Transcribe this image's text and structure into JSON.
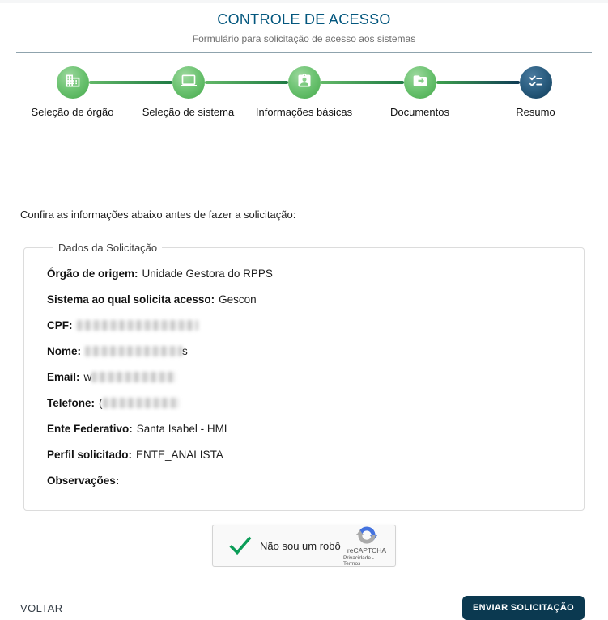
{
  "header": {
    "title": "CONTROLE DE ACESSO",
    "subtitle": "Formulário para solicitação de acesso aos sistemas"
  },
  "stepper": {
    "steps": [
      {
        "label": "Seleção de órgão",
        "icon": "building-icon",
        "state": "completed"
      },
      {
        "label": "Seleção de sistema",
        "icon": "laptop-icon",
        "state": "completed"
      },
      {
        "label": "Informações básicas",
        "icon": "person-badge-icon",
        "state": "completed"
      },
      {
        "label": "Documentos",
        "icon": "folder-move-icon",
        "state": "completed"
      },
      {
        "label": "Resumo",
        "icon": "checklist-icon",
        "state": "active"
      }
    ]
  },
  "main": {
    "instruction": "Confira as informações abaixo antes de fazer a solicitação:",
    "summary": {
      "legend": "Dados da Solicitação",
      "fields": [
        {
          "label": "Órgão de origem:",
          "value": "Unidade Gestora do RPPS",
          "masked": false
        },
        {
          "label": "Sistema ao qual solicita acesso:",
          "value": "Gescon",
          "masked": false
        },
        {
          "label": "CPF:",
          "value": "",
          "masked": true
        },
        {
          "label": "Nome:",
          "value": "",
          "masked": true,
          "suffix": "s"
        },
        {
          "label": "Email:",
          "prefix": "w",
          "value": "",
          "masked": true
        },
        {
          "label": "Telefone:",
          "prefix": "(",
          "value": "",
          "masked": true
        },
        {
          "label": "Ente Federativo:",
          "value": "Santa Isabel - HML",
          "masked": false
        },
        {
          "label": "Perfil solicitado:",
          "value": "ENTE_ANALISTA",
          "masked": false
        },
        {
          "label": "Observações:",
          "value": "",
          "masked": false
        }
      ]
    },
    "recaptcha": {
      "checked": true,
      "checkbox_label": "Não sou um robô",
      "brand": "reCAPTCHA",
      "links": "Privacidade - Termos"
    }
  },
  "footer": {
    "back_label": "VOLTAR",
    "submit_label": "ENVIAR SOLICITAÇÃO"
  },
  "colors": {
    "title_blue": "#04577e",
    "step_green": "#46a94c",
    "step_navy": "#103c58",
    "divider_gray_blue": "#8fa3ad",
    "submit_navy": "#0b3950",
    "recaptcha_check_green": "#0c9d58",
    "recaptcha_logo_blue": "#4573df"
  }
}
